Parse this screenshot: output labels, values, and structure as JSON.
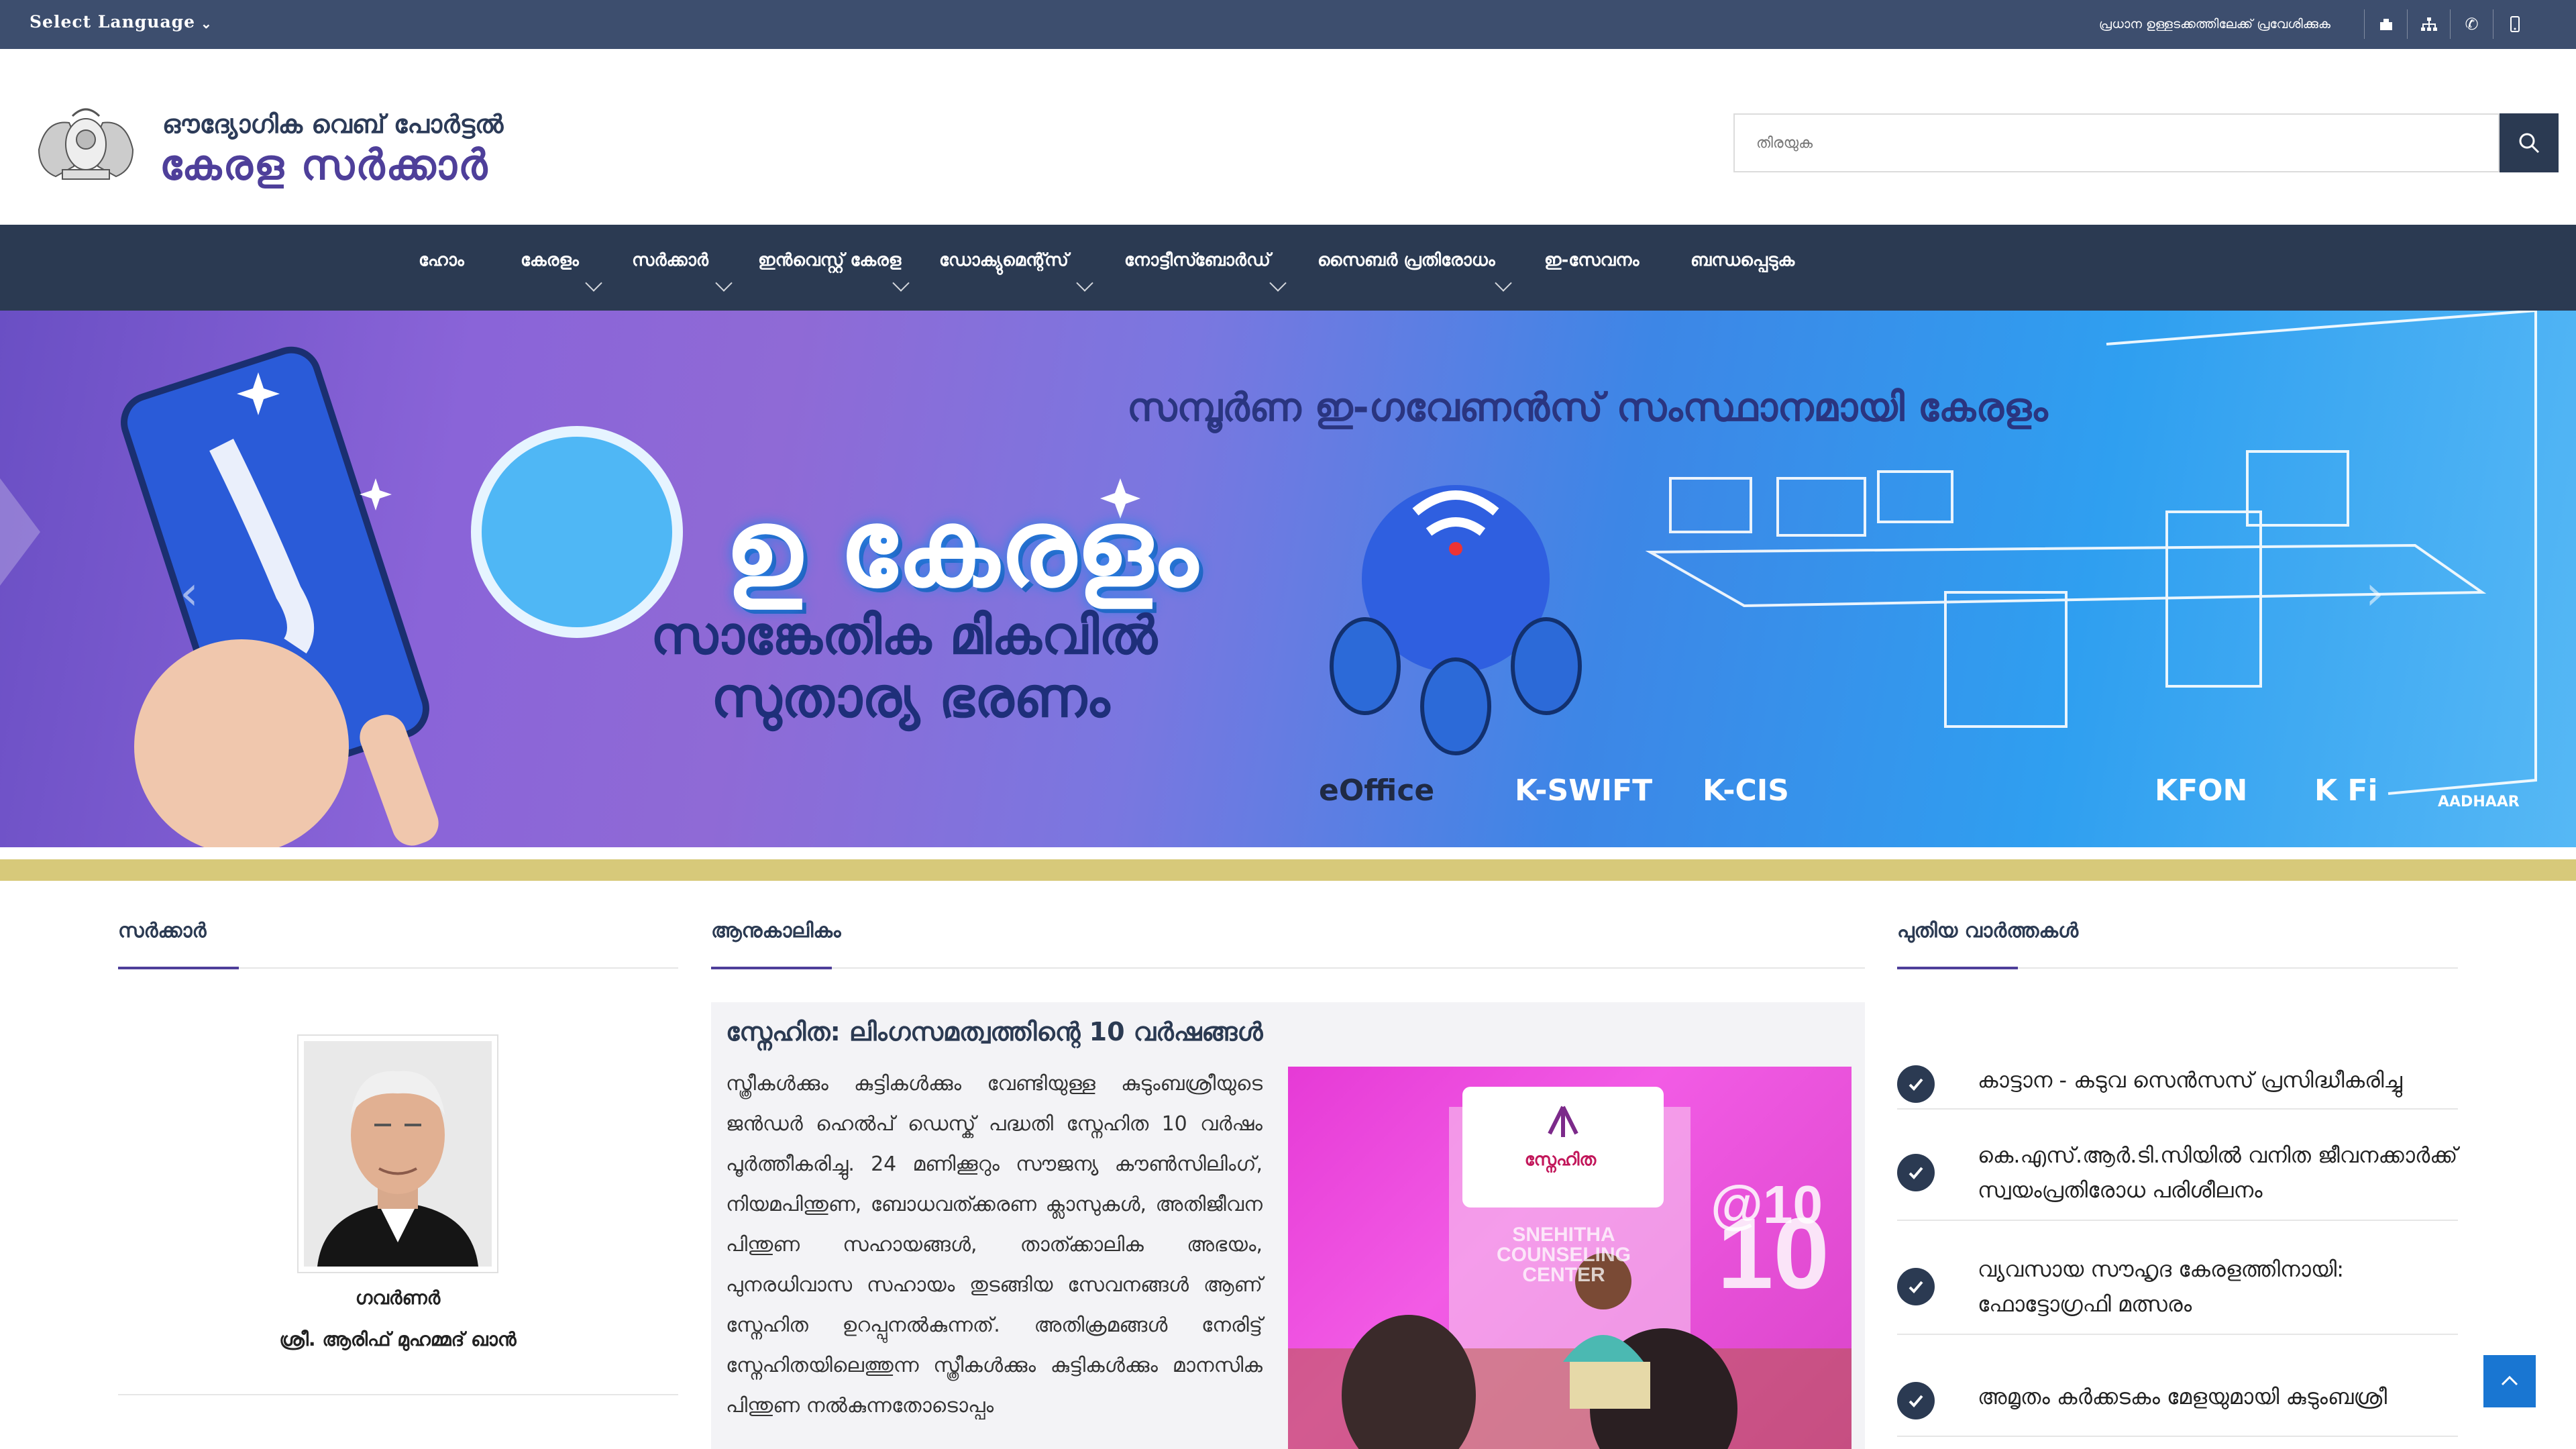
{
  "topbar": {
    "language_label": "Select Language",
    "skip_link": "പ്രധാന ഉള്ളടക്കത്തിലേക്ക് പ്രവേശിക്കുക",
    "icons": [
      "accessibility-icon",
      "sitemap-icon",
      "phone-icon",
      "mobile-icon"
    ]
  },
  "header": {
    "subtitle": "ഔദ്യോഗിക വെബ് പോർട്ടൽ",
    "title": "കേരള സർക്കാർ",
    "search_placeholder": "തിരയുക"
  },
  "nav": {
    "items": [
      {
        "label": "ഹോം",
        "has_dropdown": false
      },
      {
        "label": "കേരളം",
        "has_dropdown": true
      },
      {
        "label": "സർക്കാർ",
        "has_dropdown": true
      },
      {
        "label": "ഇൻവെസ്റ്റ് കേരള",
        "has_dropdown": true
      },
      {
        "label": "ഡോക്യുമെന്റ്സ്",
        "has_dropdown": true
      },
      {
        "label": "നോട്ടീസ്ബോർഡ്",
        "has_dropdown": true
      },
      {
        "label": "സൈബർ പ്രതിരോധം",
        "has_dropdown": true
      },
      {
        "label": "ഇ-സേവനം",
        "has_dropdown": false
      },
      {
        "label": "ബന്ധപ്പെടുക",
        "has_dropdown": false
      }
    ]
  },
  "banner": {
    "headline": "സമ്പൂർണ ഇ-ഗവേണൻസ് സംസ്ഥാനമായി കേരളം",
    "word1": "ഉ കേരളം",
    "word2": "സാങ്കേതിക മികവിൽ",
    "word3": "സുതാര്യ ഭരണം",
    "logos": [
      "eOffice",
      "K-SWIFT",
      "K-CIS",
      "KFON",
      "K Fi",
      "AADHAAR"
    ]
  },
  "columns": {
    "government": {
      "heading": "സർക്കാർ",
      "role": "ഗവർണർ",
      "name": "ശ്രീ. ആരിഫ് മുഹമ്മദ് ഖാൻ"
    },
    "current": {
      "heading": "ആനുകാലികം",
      "feature_title": "സ്നേഹിത: ലിംഗസമത്വത്തിന്റെ 10 വർഷങ്ങൾ",
      "feature_text": "സ്ത്രീകൾക്കും കുട്ടികൾക്കും വേണ്ടിയുള്ള കുടുംബശ്രീയുടെ ജൻഡർ ഹെൽപ് ഡെസ്ക് പദ്ധതി സ്നേഹിത 10 വർഷം പൂർത്തീകരിച്ചു. 24 മണിക്കൂറും സൗജന്യ കൗൺസിലിംഗ്, നിയമപിന്തുണ, ബോധവത്ക്കരണ ക്ലാസുകൾ, അതിജീവന പിന്തുണ സഹായങ്ങൾ, താത്ക്കാലിക അഭയം, പുനരധിവാസ സഹായം തുടങ്ങിയ സേവനങ്ങൾ ആണ് സ്നേഹിത ഉറപ്പുനൽകുന്നത്. അതിക്രമങ്ങൾ നേരിട്ട് സ്നേഹിതയിലെത്തുന്ന സ്ത്രീകൾക്കും കുട്ടികൾക്കും മാനസിക പിന്തുണ നൽകുന്നതോടൊപ്പം",
      "image_brand": "സ്നേഹിത",
      "image_caption": "SNEHITHA COUNSELING CENTER",
      "image_badge": "@10"
    },
    "news": {
      "heading": "പുതിയ വാർത്തകൾ",
      "items": [
        "കാട്ടാന - കടുവ സെൻസസ് പ്രസിദ്ധീകരിച്ചു",
        "കെ.എസ്.ആർ.ടി.സിയിൽ വനിത ജീവനക്കാർക്ക് സ്വയംപ്രതിരോധ പരിശീലനം",
        "വ്യവസായ സൗഹൃദ കേരളത്തിനായി: ഫോട്ടോഗ്രഫി മത്സരം",
        "അമൃതം കർക്കടകം മേളയുമായി കുടുംബശ്രീ"
      ]
    }
  }
}
